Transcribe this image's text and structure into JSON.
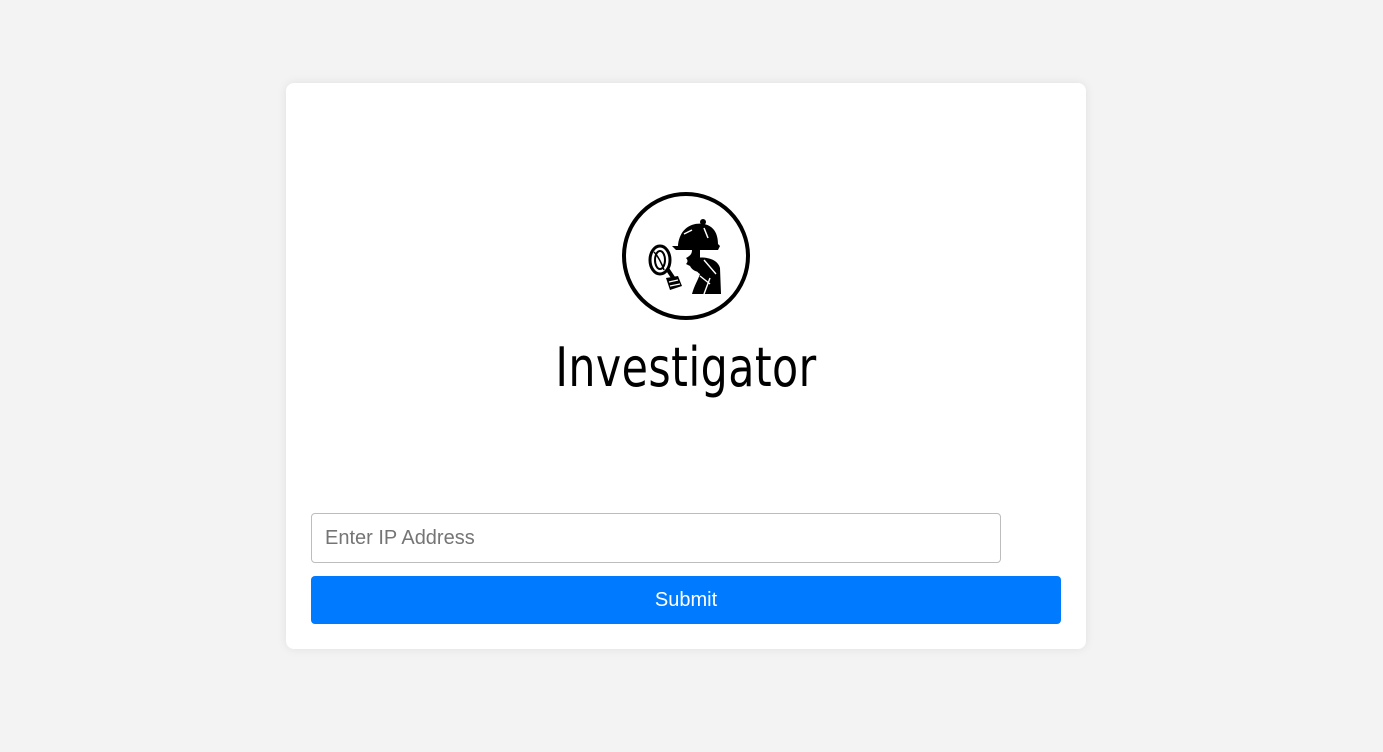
{
  "brand": {
    "title": "Investigator",
    "logo_icon": "detective-icon"
  },
  "form": {
    "ip_placeholder": "Enter IP Address",
    "ip_value": "",
    "submit_label": "Submit"
  },
  "colors": {
    "page_background": "#f3f3f3",
    "card_background": "#ffffff",
    "button_background": "#007bff",
    "button_text": "#ffffff"
  }
}
